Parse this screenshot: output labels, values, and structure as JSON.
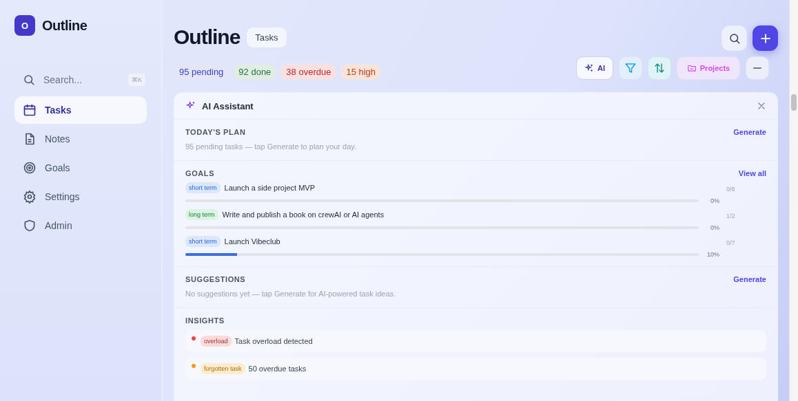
{
  "app": {
    "logo_letter": "O",
    "name": "Outline"
  },
  "sidebar": {
    "search": {
      "placeholder": "Search...",
      "shortcut": "⌘K"
    },
    "items": [
      {
        "label": "Tasks",
        "kind": "calendar",
        "selected": true
      },
      {
        "label": "Notes",
        "kind": "note",
        "selected": false
      },
      {
        "label": "Goals",
        "kind": "target",
        "selected": false
      },
      {
        "label": "Settings",
        "kind": "gear",
        "selected": false
      },
      {
        "label": "Admin",
        "kind": "shield",
        "selected": false
      }
    ]
  },
  "header": {
    "title": "Outline",
    "view": "Tasks",
    "stats": [
      {
        "label": "95 pending",
        "color": "#3f43c9"
      },
      {
        "label": "92 done",
        "color": "#1f7a3d"
      },
      {
        "label": "38 overdue",
        "color": "#c4262b"
      },
      {
        "label": "15 high",
        "color": "#c2410c"
      }
    ],
    "toolbar": {
      "ai": "AI",
      "projects": "Projects"
    }
  },
  "assistant": {
    "title": "AI Assistant",
    "plan": {
      "heading": "TODAY'S PLAN",
      "action": "Generate",
      "text": "95 pending tasks — tap Generate to plan your day."
    },
    "goals": {
      "heading": "GOALS",
      "action": "View all",
      "items": [
        {
          "tag": "short term",
          "kind": "short",
          "title": "Launch a side project MVP",
          "level": 0,
          "percent": "0%",
          "count": "0/8"
        },
        {
          "tag": "long term",
          "kind": "long",
          "title": "Write and publish a book on crewAI or AI agents",
          "level": 0,
          "percent": "0%",
          "count": "1/2"
        },
        {
          "tag": "short term",
          "kind": "short",
          "title": "Launch Vibeclub",
          "level": 0.1,
          "percent": "10%",
          "count": "0/7"
        }
      ]
    },
    "suggestions": {
      "heading": "SUGGESTIONS",
      "action": "Generate",
      "text": "No suggestions yet — tap Generate for AI-powered task ideas."
    },
    "insights": {
      "heading": "INSIGHTS",
      "items": [
        {
          "tag": "overload",
          "color": "#ef4444",
          "text": "Task overload detected"
        },
        {
          "tag": "forgotten task",
          "color": "#f59e0b",
          "text": "50 overdue tasks"
        }
      ]
    }
  }
}
